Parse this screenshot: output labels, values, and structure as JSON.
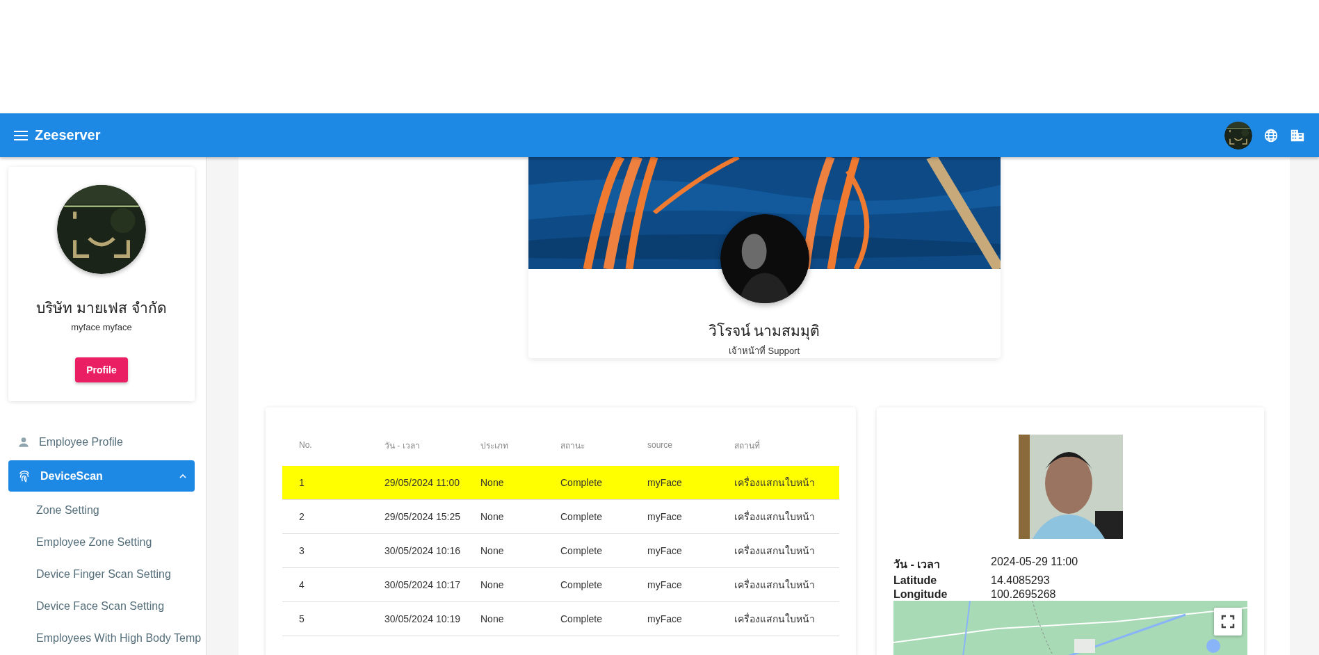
{
  "app_bar": {
    "title": "Zeeserver"
  },
  "sidebar": {
    "company": "บริษัท มายเฟส จำกัด",
    "username": "myface myface",
    "profile_button": "Profile",
    "items": [
      {
        "label": "Employee Profile",
        "kind": "person",
        "selected": false
      },
      {
        "label": "DeviceScan",
        "kind": "fingerprint",
        "selected": true,
        "expanded": true,
        "children": [
          {
            "label": "Zone Setting"
          },
          {
            "label": "Employee Zone Setting"
          },
          {
            "label": "Device Finger Scan Setting"
          },
          {
            "label": "Device Face Scan Setting"
          },
          {
            "label": "Employees With High Body Temp"
          }
        ]
      }
    ]
  },
  "profile": {
    "name": "วิโรจน์ นามสมมุติ",
    "role": "เจ้าหน้าที่ Support"
  },
  "table": {
    "columns": [
      "No.",
      "วัน - เวลา",
      "ประเภท",
      "สถานะ",
      "source",
      "สถานที่"
    ],
    "rows": [
      {
        "selected": true,
        "cells": [
          "1",
          "29/05/2024 11:00",
          "None",
          "Complete",
          "myFace",
          "เครื่องแสกนใบหน้า"
        ]
      },
      {
        "selected": false,
        "cells": [
          "2",
          "29/05/2024 15:25",
          "None",
          "Complete",
          "myFace",
          "เครื่องแสกนใบหน้า"
        ]
      },
      {
        "selected": false,
        "cells": [
          "3",
          "30/05/2024 10:16",
          "None",
          "Complete",
          "myFace",
          "เครื่องแสกนใบหน้า"
        ]
      },
      {
        "selected": false,
        "cells": [
          "4",
          "30/05/2024 10:17",
          "None",
          "Complete",
          "myFace",
          "เครื่องแสกนใบหน้า"
        ]
      },
      {
        "selected": false,
        "cells": [
          "5",
          "30/05/2024 10:19",
          "None",
          "Complete",
          "myFace",
          "เครื่องแสกนใบหน้า"
        ]
      }
    ]
  },
  "detail": {
    "fields": [
      {
        "label": "วัน - เวลา",
        "value": "2024-05-29 11:00"
      },
      {
        "label": "Latitude",
        "value": "14.4085293"
      },
      {
        "label": "Longitude",
        "value": "100.2695268"
      }
    ]
  }
}
